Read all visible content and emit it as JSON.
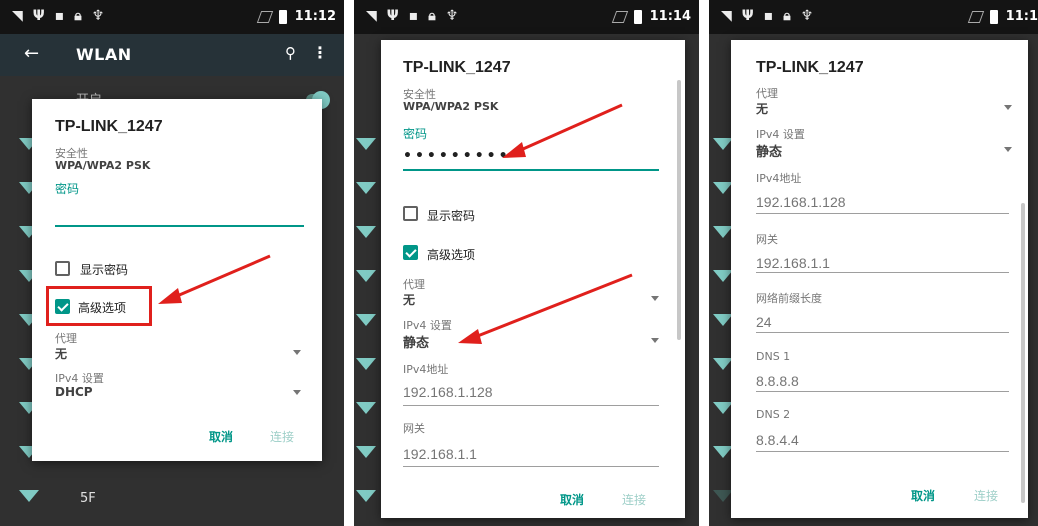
{
  "status": {
    "icons": [
      "wifi-signal-icon",
      "usb-icon",
      "sim-icon",
      "lock-icon",
      "bug-icon"
    ],
    "panel1_time": "11:12",
    "panel2_time": "11:14",
    "panel3_time": "11:1"
  },
  "wlan_screen": {
    "title": "WLAN",
    "toggle_label": "开启",
    "network_5f": "5F"
  },
  "panel1": {
    "ssid": "TP-LINK_1247",
    "security_label": "安全性",
    "security_value": "WPA/WPA2 PSK",
    "password_label": "密码",
    "password_value": "",
    "show_password": "显示密码",
    "advanced": "高级选项",
    "proxy_label": "代理",
    "proxy_value": "无",
    "ipv4_label": "IPv4 设置",
    "ipv4_value": "DHCP",
    "cancel": "取消",
    "connect": "连接"
  },
  "panel2": {
    "ssid": "TP-LINK_1247",
    "security_label": "安全性",
    "security_value": "WPA/WPA2 PSK",
    "password_label": "密码",
    "password_value": "•••••••••",
    "show_password": "显示密码",
    "advanced": "高级选项",
    "proxy_label": "代理",
    "proxy_value": "无",
    "ipv4_label": "IPv4 设置",
    "ipv4_value": "静态",
    "ip_label": "IPv4地址",
    "ip_value": "192.168.1.128",
    "gateway_label": "网关",
    "gateway_value": "192.168.1.1",
    "cancel": "取消",
    "connect": "连接"
  },
  "panel3": {
    "ssid": "TP-LINK_1247",
    "proxy_label": "代理",
    "proxy_value": "无",
    "ipv4_label": "IPv4 设置",
    "ipv4_value": "静态",
    "ip_label": "IPv4地址",
    "ip_value": "192.168.1.128",
    "gateway_label": "网关",
    "gateway_value": "192.168.1.1",
    "prefix_label": "网络前缀长度",
    "prefix_value": "24",
    "dns1_label": "DNS 1",
    "dns1_value": "8.8.8.8",
    "dns2_label": "DNS 2",
    "dns2_value": "8.8.4.4",
    "cancel": "取消",
    "connect": "连接"
  },
  "colors": {
    "accent": "#009688",
    "annotation_red": "#e0201c",
    "dialog_bg": "#ffffff",
    "screen_bg": "#303030"
  }
}
